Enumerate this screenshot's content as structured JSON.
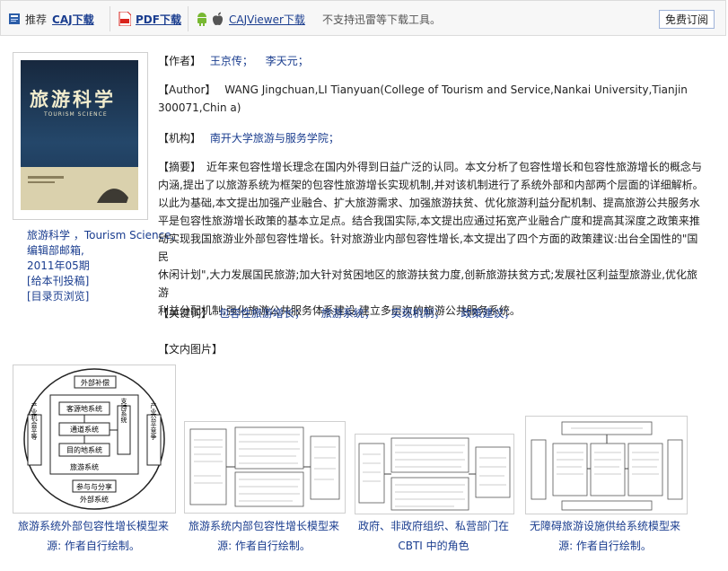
{
  "toolbar": {
    "recommend_label": "推荐",
    "caj_download": "CAJ下载",
    "pdf_download": "PDF下载",
    "cajviewer_download": "CAJViewer下载",
    "note": "不支持迅雷等下载工具。",
    "subscribe_label": "免费订阅"
  },
  "cover": {
    "title": "旅游科学",
    "subtitle": "TOURISM SCIENCE"
  },
  "journal": {
    "name": "旅游科学 ，Tourism Science,",
    "office": "编辑部邮箱,",
    "issue": "2011年05期",
    "submit_link": "[给本刊投稿]",
    "toc_link": "[目录页浏览]"
  },
  "article": {
    "author_label": "【作者】",
    "authors": [
      "王京传；",
      "李天元；"
    ],
    "author_en_label": "【Author】",
    "author_en": "WANG Jingchuan,LI Tianyuan(College of Tourism and Service,Nankai University,Tianjin 300071,Chin a)",
    "institution_label": "【机构】",
    "institution": "南开大学旅游与服务学院；",
    "abstract_label": "【摘要】",
    "abstract_lines": [
      "近年来包容性增长理念在国内外得到日益广泛的认同。本文分析了包容性增长和包容性旅游增长的概念与",
      "内涵,提出了以旅游系统为框架的包容性旅游增长实现机制,并对该机制进行了系统外部和内部两个层面的详细解析。",
      "以此为基础,本文提出加强产业融合、扩大旅游需求、加强旅游扶贫、优化旅游利益分配机制、提高旅游公共服务水",
      "平是包容性旅游增长政策的基本立足点。结合我国实际,本文提出应通过拓宽产业融合广度和提高其深度之政策来推",
      "动实现我国旅游业外部包容性增长。针对旅游业内部包容性增长,本文提出了四个方面的政策建议:出台全国性的\"国民",
      "休闲计划\",大力发展国民旅游;加大针对贫困地区的旅游扶贫力度,创新旅游扶贫方式;发展社区利益型旅游业,优化旅游",
      "利益分配机制;强化旅游公共服务体系建设,建立多层次的旅游公共服务系统。"
    ],
    "keywords_label": "【关键词】",
    "keywords": [
      "包容性旅游增长；",
      "旅游系统；",
      "实现机制；",
      "政策建议；"
    ],
    "figures_label": "【文内图片】"
  },
  "figures": [
    {
      "caption_lines": [
        "旅游系统外部包容性增长模型来",
        "源: 作者自行绘制。"
      ],
      "diagram_labels": {
        "top": "外部补偿",
        "left": "产业机会平等",
        "right": "产业公平竞争",
        "box1": "客源地系统",
        "box2": "通道系统",
        "box3": "目的地系统",
        "side": "支持系统",
        "inner": "旅游系统",
        "bottom": "参与与分享",
        "outer": "外部系统"
      }
    },
    {
      "caption_lines": [
        "旅游系统内部包容性增长模型来",
        "源: 作者自行绘制。"
      ]
    },
    {
      "caption_lines": [
        "政府、非政府组织、私营部门在",
        "CBTI 中的角色"
      ]
    },
    {
      "caption_lines": [
        "无障碍旅游设施供给系统模型来",
        "源: 作者自行绘制。"
      ]
    }
  ],
  "colors": {
    "link": "#1a3d8f",
    "pdf_red": "#d9231c",
    "android_green": "#78b832"
  }
}
